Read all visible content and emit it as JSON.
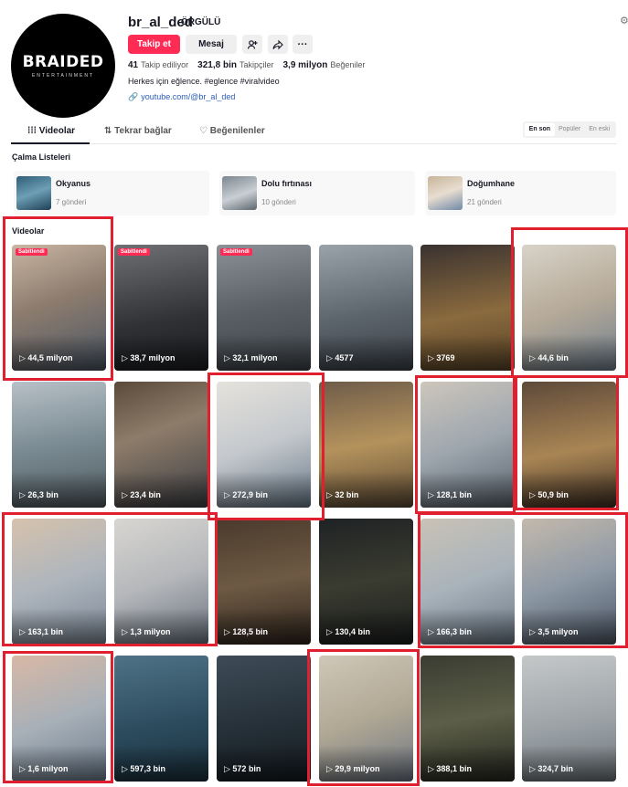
{
  "profile": {
    "avatar_logo": "BRAIDED",
    "avatar_logo_sub": "ENTERTAINMENT",
    "username": "br_al_ded",
    "nickname": "ÖRGÜLÜ",
    "follow_label": "Takip et",
    "message_label": "Mesaj",
    "following_count": "41",
    "following_label": "Takip ediliyor",
    "followers_count": "321,8 bin",
    "followers_label": "Takipçiler",
    "likes_count": "3,9 milyon",
    "likes_label": "Beğeniler",
    "bio": "Herkes için eğlence. #eglence #viralvideo",
    "link": "youtube.com/@br_al_ded"
  },
  "tabs": [
    {
      "label": "Videolar"
    },
    {
      "label": "Tekrar bağlar"
    },
    {
      "label": "Beğenilenler"
    }
  ],
  "sort": [
    "En son",
    "Popüler",
    "En eski"
  ],
  "playlists_title": "Çalma Listeleri",
  "playlists": [
    {
      "name": "Okyanus",
      "count": "7 gönderi"
    },
    {
      "name": "Dolu fırtınası",
      "count": "10 gönderi"
    },
    {
      "name": "Doğumhane",
      "count": "21 gönderi"
    }
  ],
  "videos_title": "Videolar",
  "pinned_label": "Sabitlendi",
  "videos": [
    {
      "views": "44,5 milyon"
    },
    {
      "views": "38,7 milyon"
    },
    {
      "views": "32,1 milyon"
    },
    {
      "views": "4577"
    },
    {
      "views": "3769"
    },
    {
      "views": "44,6 bin"
    },
    {
      "views": "26,3 bin"
    },
    {
      "views": "23,4 bin"
    },
    {
      "views": "272,9 bin"
    },
    {
      "views": "32 bin"
    },
    {
      "views": "128,1 bin"
    },
    {
      "views": "50,9 bin"
    },
    {
      "views": "163,1 bin"
    },
    {
      "views": "1,3 milyon"
    },
    {
      "views": "128,5 bin"
    },
    {
      "views": "130,4 bin"
    },
    {
      "views": "166,3 bin"
    },
    {
      "views": "3,5 milyon"
    },
    {
      "views": "1,6 milyon"
    },
    {
      "views": "597,3 bin"
    },
    {
      "views": "572 bin"
    },
    {
      "views": "29,9 milyon"
    },
    {
      "views": "388,1 bin"
    },
    {
      "views": "324,7 bin"
    }
  ],
  "colors": {
    "accent": "#fe2c55",
    "highlight_frame": "#e0202e"
  }
}
